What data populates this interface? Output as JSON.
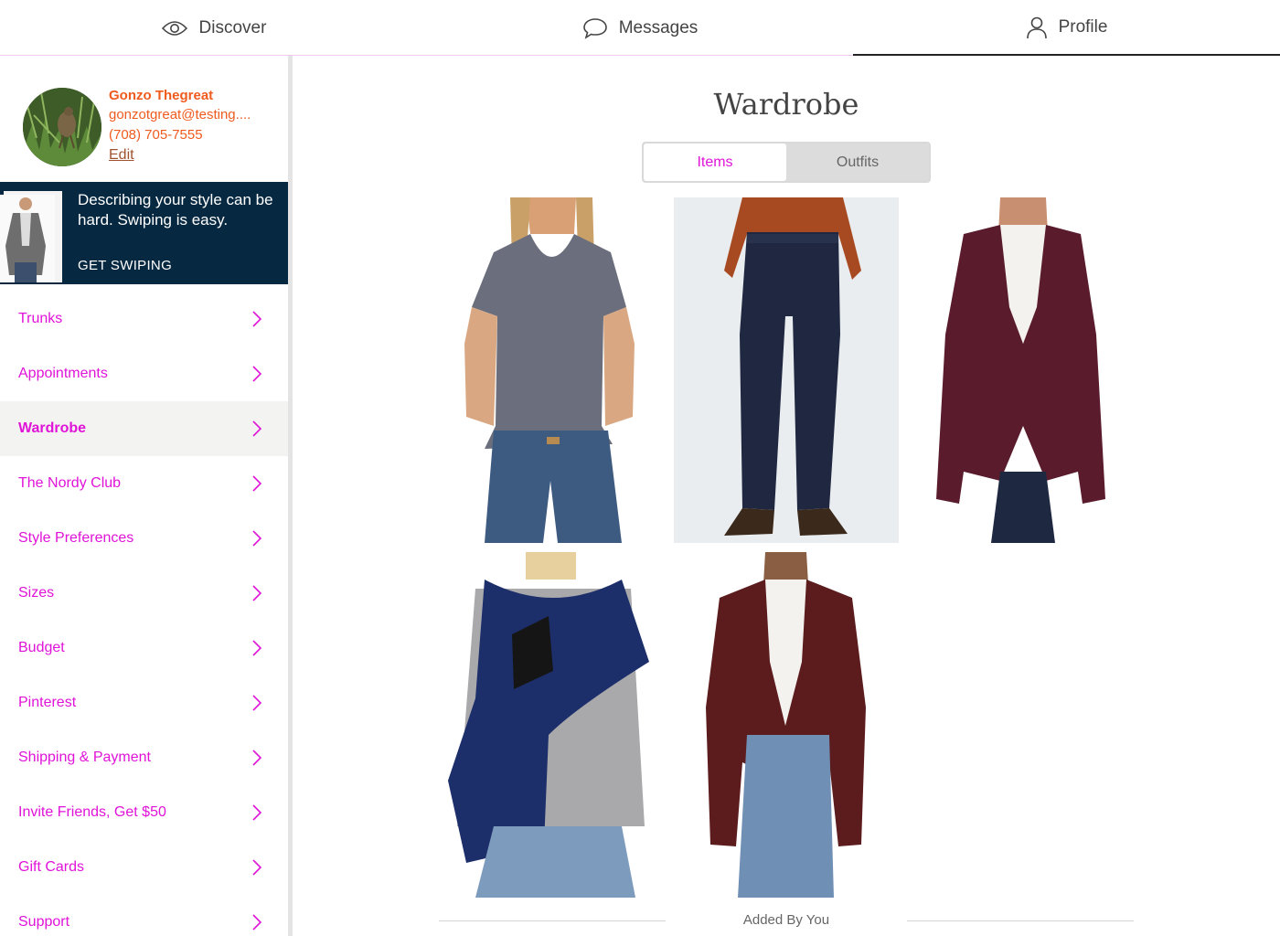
{
  "topnav": {
    "tabs": [
      {
        "label": "Discover",
        "icon": "eye-icon"
      },
      {
        "label": "Messages",
        "icon": "chat-bubble-icon"
      },
      {
        "label": "Profile",
        "icon": "person-icon",
        "active": true
      }
    ]
  },
  "profile": {
    "name": "Gonzo Thegreat",
    "email": "gonzotgreat@testing....",
    "phone": "(708) 705-7555",
    "edit_label": "Edit"
  },
  "promo": {
    "text": "Describing your style can be hard. Swiping is easy.",
    "cta": "GET SWIPING"
  },
  "menu": {
    "items": [
      {
        "label": "Trunks"
      },
      {
        "label": "Appointments"
      },
      {
        "label": "Wardrobe",
        "active": true
      },
      {
        "label": "The Nordy Club"
      },
      {
        "label": "Style Preferences"
      },
      {
        "label": "Sizes"
      },
      {
        "label": "Budget"
      },
      {
        "label": "Pinterest"
      },
      {
        "label": "Shipping & Payment"
      },
      {
        "label": "Invite Friends, Get $50"
      },
      {
        "label": "Gift Cards"
      },
      {
        "label": "Support"
      }
    ]
  },
  "main": {
    "title": "Wardrobe",
    "segments": [
      {
        "label": "Items",
        "active": true
      },
      {
        "label": "Outfits",
        "active": false
      }
    ],
    "items": [
      {
        "name": "gray-scoop-tee"
      },
      {
        "name": "navy-trousers"
      },
      {
        "name": "burgundy-blazer"
      },
      {
        "name": "blue-faux-fur-scarf"
      },
      {
        "name": "burgundy-leather-jacket"
      }
    ],
    "section_label": "Added By You"
  },
  "colors": {
    "accent": "#e013d8",
    "orange": "#ef5b1f",
    "promo_bg": "#062841"
  }
}
